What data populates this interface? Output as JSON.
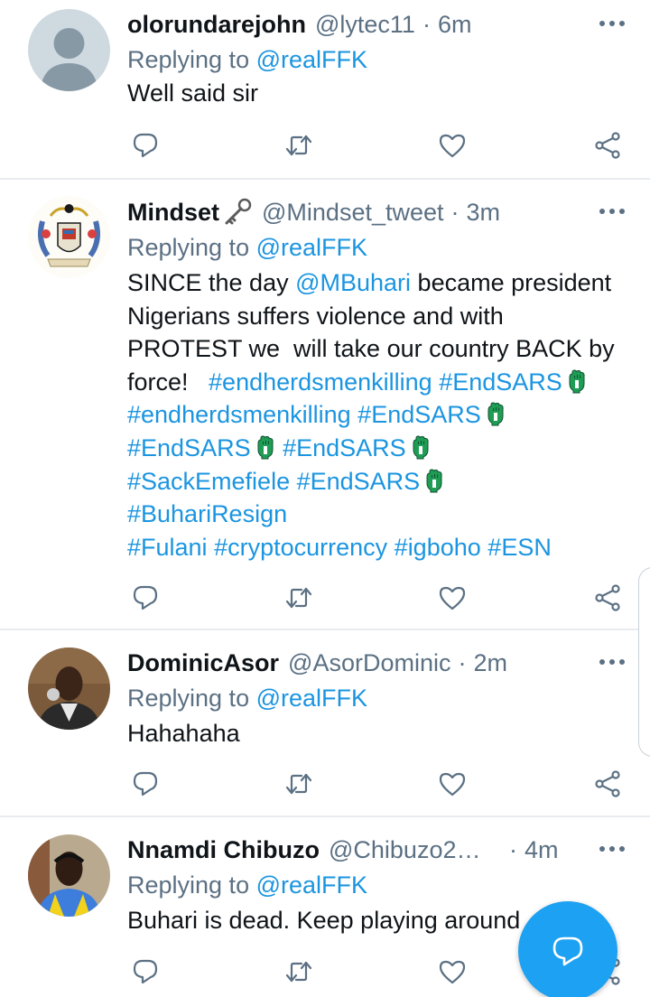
{
  "tweets": [
    {
      "name": "olorundarejohn",
      "handle": "@lytec11",
      "time": "6m",
      "replying_label": "Replying to",
      "replying_to": "@realFFK",
      "text": "Well said sir",
      "avatar": "default-avatar"
    },
    {
      "name": "Mindset",
      "name_emoji": "old-key-icon",
      "handle": "@Mindset_tweet",
      "time": "3m",
      "replying_label": "Replying to",
      "replying_to": "@realFFK",
      "text_parts": {
        "p1": "SINCE the day ",
        "mention": "@MBuhari",
        "p2": " became president Nigerians suffers violence and with PROTEST we  will take our country BACK by force!   ",
        "t1": "#endherdsmenkilling",
        "t2": "#EndSARS",
        "t3": "#endherdsmenkilling",
        "t4": "#EndSARS",
        "t5": "#EndSARS",
        "t6": "#EndSARS",
        "t7": "#SackEmefiele",
        "t8": "#EndSARS",
        "t9": "#BuhariResign",
        "t10": "#Fulani",
        "t11": "#cryptocurrency",
        "t12": "#igboho",
        "t13": "#ESN"
      },
      "avatar": "coat-of-arms-avatar"
    },
    {
      "name": "DominicAsor",
      "handle": "@AsorDominic",
      "time": "2m",
      "replying_label": "Replying to",
      "replying_to": "@realFFK",
      "text": "Hahahaha",
      "avatar": "photo-avatar"
    },
    {
      "name": "Nnamdi Chibuzo",
      "handle": "@Chibuzo2C...",
      "time": "4m",
      "replying_label": "Replying to",
      "replying_to": "@realFFK",
      "text": "Buhari is dead. Keep playing around",
      "avatar": "photo-avatar"
    }
  ],
  "separator": "·",
  "actions": [
    "reply-icon",
    "retweet-icon",
    "like-icon",
    "share-icon"
  ],
  "fab_icon": "compose-reply-icon",
  "colors": {
    "accent": "#1da1f2",
    "link": "#1b95e0",
    "muted": "#5b7083",
    "text": "#0f1419",
    "divider": "#e8ecef",
    "fist_green": "#1f9d55"
  }
}
